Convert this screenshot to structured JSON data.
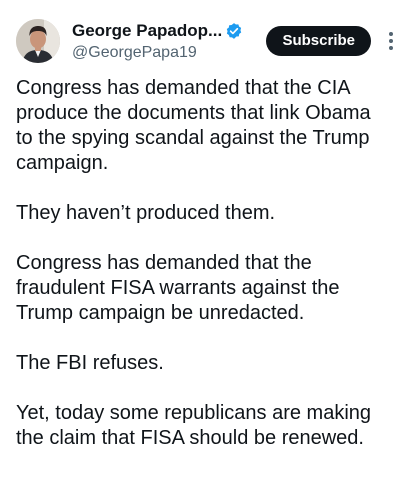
{
  "author": {
    "display_name": "George Papadop...",
    "handle": "@GeorgePapa19",
    "avatar": "avatar-photo",
    "verified_icon": "verified-badge-icon",
    "verified_color": "#1d9bf0"
  },
  "actions": {
    "subscribe_label": "Subscribe",
    "more_icon": "more-vertical-icon"
  },
  "tweet": {
    "paragraphs": [
      "Congress has demanded that the CIA\nproduce the documents that link Obama\nto the spying scandal against the Trump\ncampaign.",
      "They haven’t produced them.",
      "Congress has demanded that the\nfraudulent FISA warrants against the\nTrump campaign be unredacted.",
      "The FBI refuses.",
      "Yet, today some republicans are making\nthe claim that FISA should be renewed."
    ]
  },
  "colors": {
    "text": "#0f1419",
    "secondary": "#536471",
    "button_bg": "#0f1419",
    "button_text": "#ffffff",
    "background": "#ffffff"
  }
}
